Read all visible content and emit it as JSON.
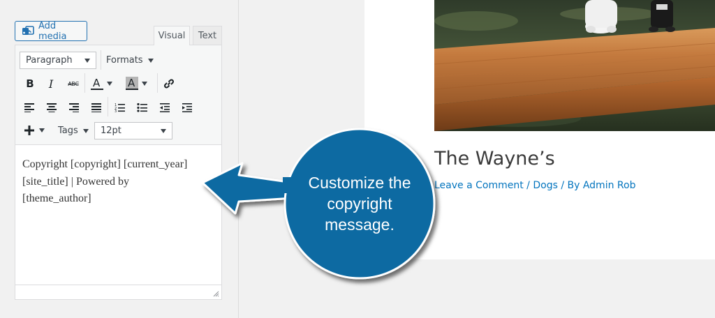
{
  "editor": {
    "add_media_label": "Add media",
    "tabs": {
      "visual": "Visual",
      "text": "Text"
    },
    "toolbar": {
      "block_format": "Paragraph",
      "formats_label": "Formats",
      "tags_label": "Tags",
      "font_size": "12pt"
    },
    "content_lines": [
      "Copyright [copyright] [current_year]",
      "[site_title] | Powered by",
      "[theme_author]"
    ]
  },
  "preview": {
    "title": "The Wayne’s",
    "meta": {
      "comment_link": "Leave a Comment",
      "separator": "/",
      "category": "Dogs",
      "by_author": "By Admin Rob"
    }
  },
  "callout": {
    "lines": [
      "Customize the",
      "copyright",
      "message."
    ],
    "color": "#0f6aa2"
  },
  "colors": {
    "accent": "#2271b1",
    "link": "#0274be"
  }
}
